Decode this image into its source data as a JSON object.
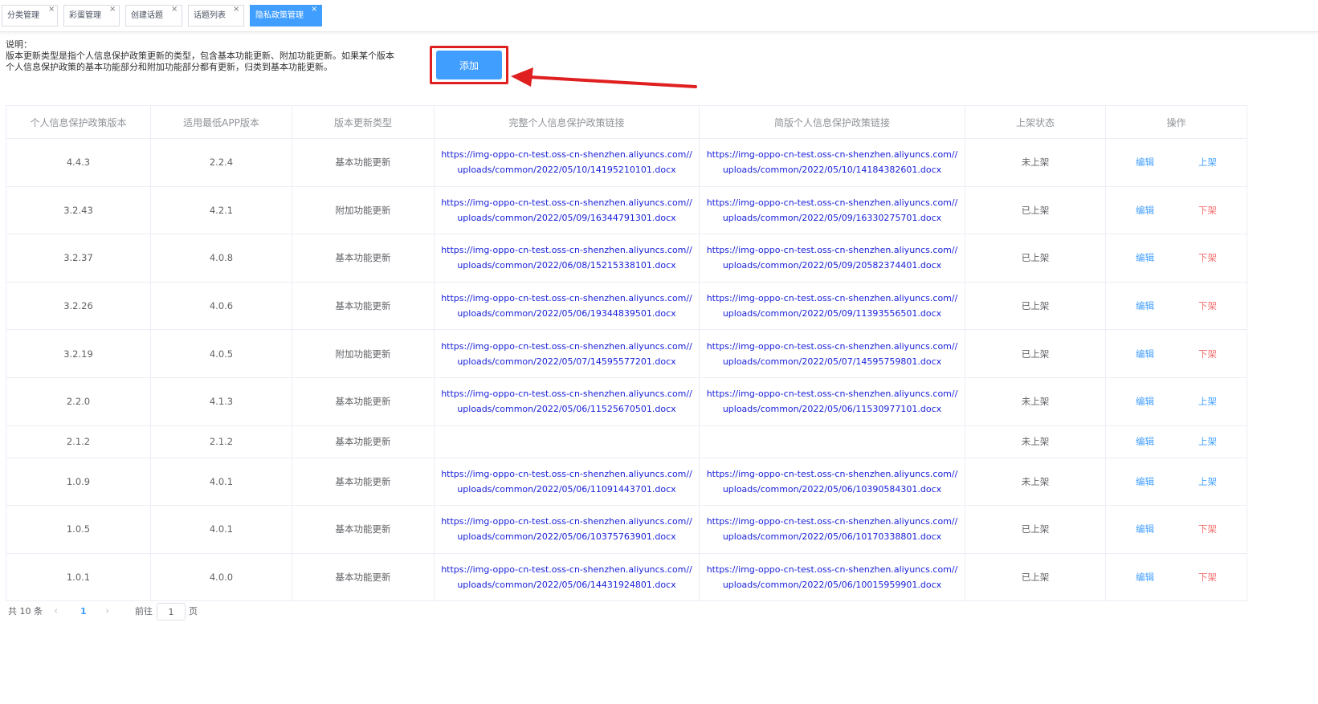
{
  "tabs": [
    {
      "label": "分类管理",
      "active": false
    },
    {
      "label": "彩蛋管理",
      "active": false
    },
    {
      "label": "创建话题",
      "active": false
    },
    {
      "label": "话题列表",
      "active": false
    },
    {
      "label": "隐私政策管理",
      "active": true
    }
  ],
  "tab_close_glyph": "×",
  "description": {
    "title": "说明：",
    "line1": "版本更新类型是指个人信息保护政策更新的类型，包含基本功能更新、附加功能更新。如果某个版本",
    "line2": "个人信息保护政策的基本功能部分和附加功能部分都有更新，归类到基本功能更新。"
  },
  "add_button_label": "添加",
  "annotation_color": "#e02020",
  "accent_color": "#409eff",
  "table": {
    "headers": [
      "个人信息保护政策版本",
      "适用最低APP版本",
      "版本更新类型",
      "完整个人信息保护政策链接",
      "简版个人信息保护政策链接",
      "上架状态",
      "操作"
    ],
    "rows": [
      {
        "version": "4.4.3",
        "min_app": "2.2.4",
        "type": "基本功能更新",
        "full_link": "https://img-oppo-cn-test.oss-cn-shenzhen.aliyuncs.com//uploads/common/2022/05/10/14195210101.docx",
        "brief_link": "https://img-oppo-cn-test.oss-cn-shenzhen.aliyuncs.com//uploads/common/2022/05/10/14184382601.docx",
        "status": "未上架",
        "edit": "编辑",
        "toggle": "上架"
      },
      {
        "version": "3.2.43",
        "min_app": "4.2.1",
        "type": "附加功能更新",
        "full_link": "https://img-oppo-cn-test.oss-cn-shenzhen.aliyuncs.com//uploads/common/2022/05/09/16344791301.docx",
        "brief_link": "https://img-oppo-cn-test.oss-cn-shenzhen.aliyuncs.com//uploads/common/2022/05/09/16330275701.docx",
        "status": "已上架",
        "edit": "编辑",
        "toggle": "下架"
      },
      {
        "version": "3.2.37",
        "min_app": "4.0.8",
        "type": "基本功能更新",
        "full_link": "https://img-oppo-cn-test.oss-cn-shenzhen.aliyuncs.com//uploads/common/2022/06/08/15215338101.docx",
        "brief_link": "https://img-oppo-cn-test.oss-cn-shenzhen.aliyuncs.com//uploads/common/2022/05/09/20582374401.docx",
        "status": "已上架",
        "edit": "编辑",
        "toggle": "下架"
      },
      {
        "version": "3.2.26",
        "min_app": "4.0.6",
        "type": "基本功能更新",
        "full_link": "https://img-oppo-cn-test.oss-cn-shenzhen.aliyuncs.com//uploads/common/2022/05/06/19344839501.docx",
        "brief_link": "https://img-oppo-cn-test.oss-cn-shenzhen.aliyuncs.com//uploads/common/2022/05/09/11393556501.docx",
        "status": "已上架",
        "edit": "编辑",
        "toggle": "下架"
      },
      {
        "version": "3.2.19",
        "min_app": "4.0.5",
        "type": "附加功能更新",
        "full_link": "https://img-oppo-cn-test.oss-cn-shenzhen.aliyuncs.com//uploads/common/2022/05/07/14595577201.docx",
        "brief_link": "https://img-oppo-cn-test.oss-cn-shenzhen.aliyuncs.com//uploads/common/2022/05/07/14595759801.docx",
        "status": "已上架",
        "edit": "编辑",
        "toggle": "下架"
      },
      {
        "version": "2.2.0",
        "min_app": "4.1.3",
        "type": "基本功能更新",
        "full_link": "https://img-oppo-cn-test.oss-cn-shenzhen.aliyuncs.com//uploads/common/2022/05/06/11525670501.docx",
        "brief_link": "https://img-oppo-cn-test.oss-cn-shenzhen.aliyuncs.com//uploads/common/2022/05/06/11530977101.docx",
        "status": "未上架",
        "edit": "编辑",
        "toggle": "上架"
      },
      {
        "version": "2.1.2",
        "min_app": "2.1.2",
        "type": "基本功能更新",
        "full_link": "",
        "brief_link": "",
        "status": "未上架",
        "edit": "编辑",
        "toggle": "上架"
      },
      {
        "version": "1.0.9",
        "min_app": "4.0.1",
        "type": "基本功能更新",
        "full_link": "https://img-oppo-cn-test.oss-cn-shenzhen.aliyuncs.com//uploads/common/2022/05/06/11091443701.docx",
        "brief_link": "https://img-oppo-cn-test.oss-cn-shenzhen.aliyuncs.com//uploads/common/2022/05/06/10390584301.docx",
        "status": "未上架",
        "edit": "编辑",
        "toggle": "上架"
      },
      {
        "version": "1.0.5",
        "min_app": "4.0.1",
        "type": "基本功能更新",
        "full_link": "https://img-oppo-cn-test.oss-cn-shenzhen.aliyuncs.com//uploads/common/2022/05/06/10375763901.docx",
        "brief_link": "https://img-oppo-cn-test.oss-cn-shenzhen.aliyuncs.com//uploads/common/2022/05/06/10170338801.docx",
        "status": "已上架",
        "edit": "编辑",
        "toggle": "下架"
      },
      {
        "version": "1.0.1",
        "min_app": "4.0.0",
        "type": "基本功能更新",
        "full_link": "https://img-oppo-cn-test.oss-cn-shenzhen.aliyuncs.com//uploads/common/2022/05/06/14431924801.docx",
        "brief_link": "https://img-oppo-cn-test.oss-cn-shenzhen.aliyuncs.com//uploads/common/2022/05/06/10015959901.docx",
        "status": "已上架",
        "edit": "编辑",
        "toggle": "下架"
      }
    ]
  },
  "pagination": {
    "total": "共 10 条",
    "prev": "‹",
    "current_page": "1",
    "next": "›",
    "goto_label": "前往",
    "goto_value": "1",
    "page_unit": "页"
  }
}
